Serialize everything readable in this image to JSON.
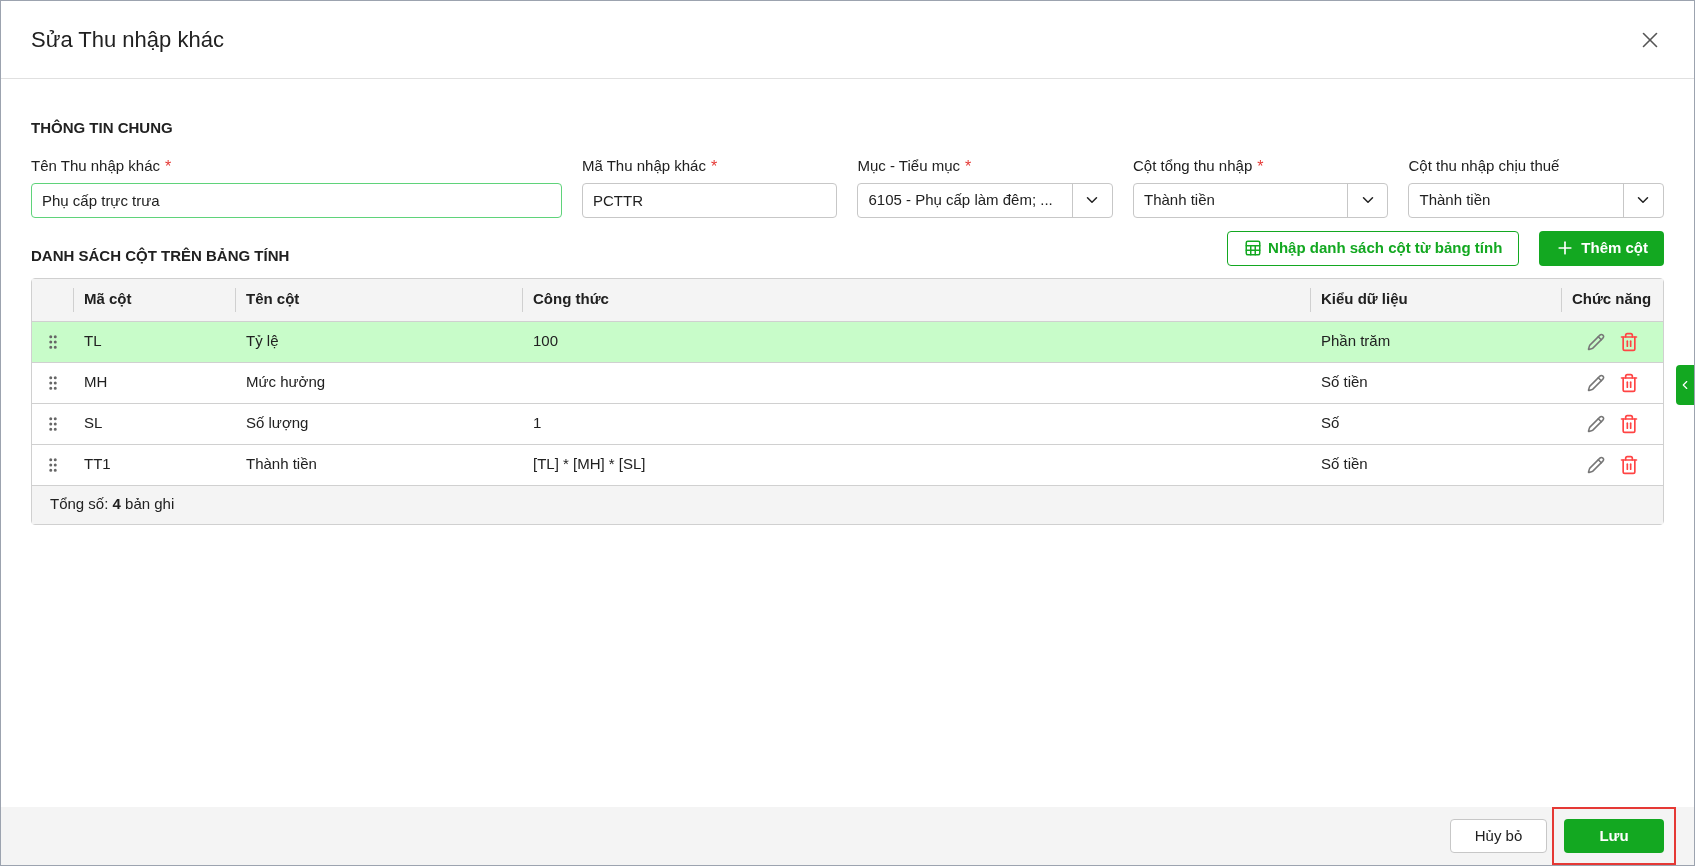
{
  "dialog": {
    "title": "Sửa Thu nhập khác"
  },
  "general": {
    "heading": "THÔNG TIN CHUNG",
    "fields": [
      {
        "kind": "text",
        "label": "Tên Thu nhập khác",
        "required_mark": "*",
        "value": "Phụ cấp trực trưa",
        "focused": true
      },
      {
        "kind": "text",
        "label": "Mã Thu nhập khác",
        "required_mark": "*",
        "value": "PCTTR",
        "focused": false
      },
      {
        "kind": "select",
        "label": "Mục - Tiểu mục",
        "required_mark": "*",
        "value": "6105 - Phụ cấp làm đêm; ...",
        "focused": false
      },
      {
        "kind": "select",
        "label": "Cột tổng thu nhập",
        "required_mark": "*",
        "value": "Thành tiền",
        "focused": false
      },
      {
        "kind": "select",
        "label": "Cột thu nhập chịu thuế",
        "value": "Thành tiền",
        "focused": false
      }
    ]
  },
  "columns_section": {
    "heading": "DANH SÁCH CỘT TRÊN BẢNG TÍNH",
    "import_button": "Nhập danh sách cột từ bảng tính",
    "add_button": "Thêm cột"
  },
  "table": {
    "columns": [
      "Mã cột",
      "Tên cột",
      "Công thức",
      "Kiểu dữ liệu",
      "Chức năng"
    ],
    "rows": [
      {
        "code": "TL",
        "name": "Tỷ lệ",
        "formula": "100",
        "type": "Phần trăm",
        "selected": true
      },
      {
        "code": "MH",
        "name": "Mức hưởng",
        "formula": "",
        "type": "Số tiền",
        "selected": false
      },
      {
        "code": "SL",
        "name": "Số lượng",
        "formula": "1",
        "type": "Số",
        "selected": false
      },
      {
        "code": "TT1",
        "name": "Thành tiền",
        "formula": "[TL] * [MH] * [SL]",
        "type": "Số tiền",
        "selected": false
      }
    ],
    "footer": "Tổng số: **4** bản ghi"
  },
  "footer": {
    "cancel": "Hủy bỏ",
    "save": "Lưu",
    "save_highlighted": true
  }
}
